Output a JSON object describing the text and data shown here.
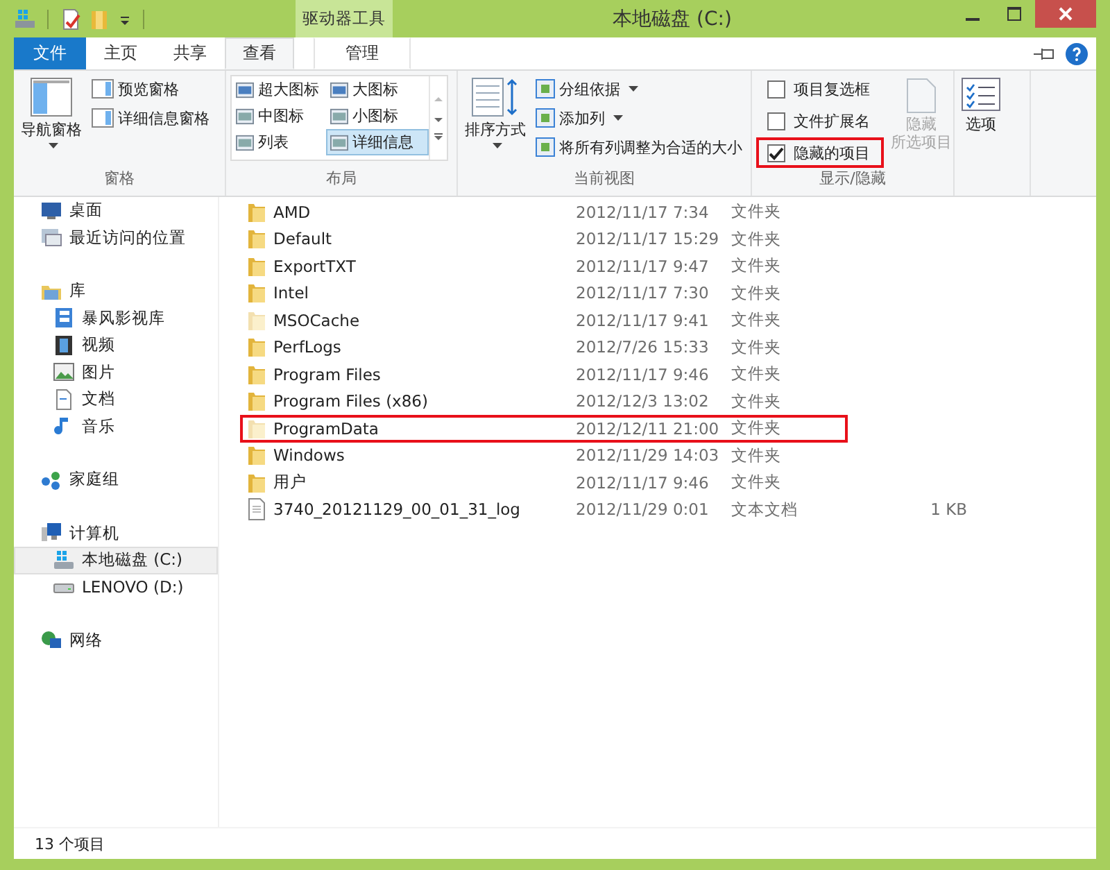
{
  "window": {
    "title": "本地磁盘 (C:)",
    "context_tab_header": "驱动器工具"
  },
  "tabs": [
    {
      "label": "文件",
      "kind": "file",
      "selected": false
    },
    {
      "label": "主页",
      "kind": "normal",
      "selected": false
    },
    {
      "label": "共享",
      "kind": "normal",
      "selected": false
    },
    {
      "label": "查看",
      "kind": "normal",
      "selected": true
    },
    {
      "label": "管理",
      "kind": "context",
      "selected": false
    }
  ],
  "ribbon": {
    "panes": {
      "label": "窗格",
      "big_button": "导航窗格",
      "small_buttons": [
        "预览窗格",
        "详细信息窗格"
      ]
    },
    "layout": {
      "label": "布局",
      "options": [
        {
          "label": "超大图标",
          "selected": false
        },
        {
          "label": "大图标",
          "selected": false
        },
        {
          "label": "中图标",
          "selected": false
        },
        {
          "label": "小图标",
          "selected": false
        },
        {
          "label": "列表",
          "selected": false
        },
        {
          "label": "详细信息",
          "selected": true
        }
      ]
    },
    "current_view": {
      "label": "当前视图",
      "big_button": "排序方式",
      "small_buttons": [
        {
          "label": "分组依据",
          "dropdown": true
        },
        {
          "label": "添加列",
          "dropdown": true
        },
        {
          "label": "将所有列调整为合适的大小",
          "dropdown": false
        }
      ]
    },
    "show_hide": {
      "label": "显示/隐藏",
      "checkboxes": [
        {
          "label": "项目复选框",
          "checked": false,
          "highlighted": false
        },
        {
          "label": "文件扩展名",
          "checked": false,
          "highlighted": false
        },
        {
          "label": "隐藏的项目",
          "checked": true,
          "highlighted": true
        }
      ],
      "hide_button": {
        "lines": [
          "隐藏",
          "所选项目"
        ],
        "disabled": true
      }
    },
    "options": {
      "label": "选项"
    }
  },
  "nav": [
    {
      "label": "桌面",
      "kind": "desktop",
      "selected": false
    },
    {
      "label": "最近访问的位置",
      "kind": "recent",
      "selected": false
    },
    {
      "label": "库",
      "kind": "library",
      "selected": false,
      "children": [
        {
          "label": "暴风影视库",
          "kind": "media",
          "selected": false
        },
        {
          "label": "视频",
          "kind": "video",
          "selected": false
        },
        {
          "label": "图片",
          "kind": "pictures",
          "selected": false
        },
        {
          "label": "文档",
          "kind": "documents",
          "selected": false
        },
        {
          "label": "音乐",
          "kind": "music",
          "selected": false
        }
      ]
    },
    {
      "label": "家庭组",
      "kind": "homegroup",
      "selected": false
    },
    {
      "label": "计算机",
      "kind": "computer",
      "selected": false,
      "children": [
        {
          "label": "本地磁盘 (C:)",
          "kind": "system-drive",
          "selected": true
        },
        {
          "label": "LENOVO (D:)",
          "kind": "drive",
          "selected": false
        }
      ]
    },
    {
      "label": "网络",
      "kind": "network",
      "selected": false
    }
  ],
  "files": [
    {
      "name": "AMD",
      "date": "2012/11/17 7:34",
      "type": "文件夹",
      "kind": "folder",
      "hidden": false,
      "highlighted": false
    },
    {
      "name": "Default",
      "date": "2012/11/17 15:29",
      "type": "文件夹",
      "kind": "folder",
      "hidden": false,
      "highlighted": false
    },
    {
      "name": "ExportTXT",
      "date": "2012/11/17 9:47",
      "type": "文件夹",
      "kind": "folder",
      "hidden": false,
      "highlighted": false
    },
    {
      "name": "Intel",
      "date": "2012/11/17 7:30",
      "type": "文件夹",
      "kind": "folder",
      "hidden": false,
      "highlighted": false
    },
    {
      "name": "MSOCache",
      "date": "2012/11/17 9:41",
      "type": "文件夹",
      "kind": "folder",
      "hidden": true,
      "highlighted": false
    },
    {
      "name": "PerfLogs",
      "date": "2012/7/26 15:33",
      "type": "文件夹",
      "kind": "folder",
      "hidden": false,
      "highlighted": false
    },
    {
      "name": "Program Files",
      "date": "2012/11/17 9:46",
      "type": "文件夹",
      "kind": "folder",
      "hidden": false,
      "highlighted": false
    },
    {
      "name": "Program Files (x86)",
      "date": "2012/12/3 13:02",
      "type": "文件夹",
      "kind": "folder",
      "hidden": false,
      "highlighted": false
    },
    {
      "name": "ProgramData",
      "date": "2012/12/11 21:00",
      "type": "文件夹",
      "kind": "folder",
      "hidden": true,
      "highlighted": true
    },
    {
      "name": "Windows",
      "date": "2012/11/29 14:03",
      "type": "文件夹",
      "kind": "folder",
      "hidden": false,
      "highlighted": false
    },
    {
      "name": "用户",
      "date": "2012/11/17 9:46",
      "type": "文件夹",
      "kind": "folder",
      "hidden": false,
      "highlighted": false
    },
    {
      "name": "3740_20121129_00_01_31_log",
      "date": "2012/11/29 0:01",
      "type": "文本文档",
      "size": "1 KB",
      "kind": "text",
      "hidden": false,
      "highlighted": false
    }
  ],
  "status_bar": {
    "item_count": "13 个项目"
  }
}
